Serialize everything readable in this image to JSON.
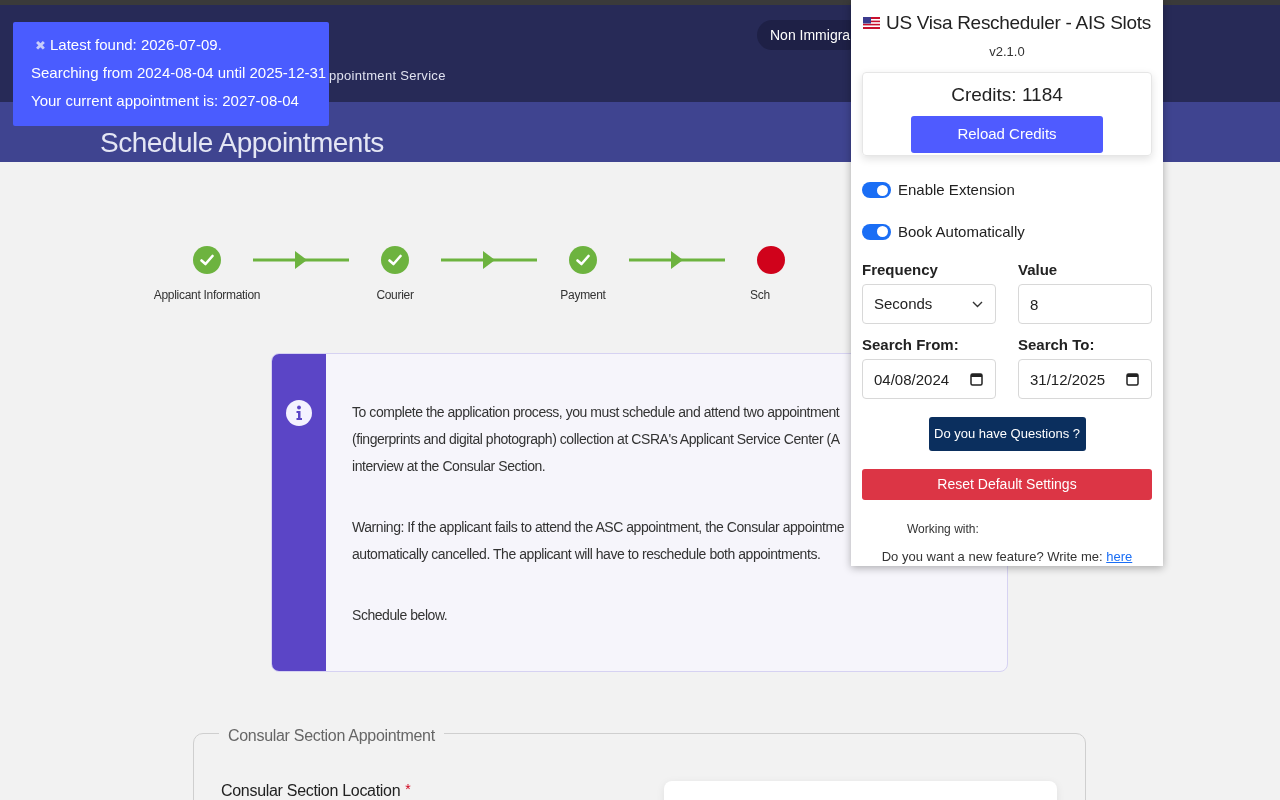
{
  "header": {
    "visa_pill": "Non Immigra",
    "service_text": "ppointment Service"
  },
  "banner": {
    "title": "Schedule Appointments"
  },
  "stepper": [
    {
      "label": "Applicant Information",
      "completed": true
    },
    {
      "label": "Courier",
      "completed": true
    },
    {
      "label": "Payment",
      "completed": true
    },
    {
      "label": "Sch",
      "completed": false
    }
  ],
  "info_box": {
    "paragraphs": [
      [
        "To complete the application process, you must schedule and attend two appointment",
        "(fingerprints and digital photograph) collection at CSRA's Applicant Service Center (A",
        "interview at the Consular Section."
      ],
      [
        "Warning: If the applicant fails to attend the ASC appointment, the Consular appointme",
        "automatically cancelled. The applicant will have to reschedule both appointments."
      ],
      [
        "Schedule below."
      ]
    ]
  },
  "consular_section": {
    "legend": "Consular Section Appointment",
    "location_label": "Consular Section Location",
    "required_mark": "*"
  },
  "notification": {
    "close_glyph": "✖",
    "lines": [
      "Latest found: 2026-07-09.",
      "Searching from 2024-08-04 until 2025-12-31",
      "Your current appointment is: 2027-08-04"
    ]
  },
  "popup": {
    "title": "US Visa Rescheduler - AIS Slots",
    "version": "v2.1.0",
    "credits": "Credits: 1184",
    "reload_button": "Reload Credits",
    "toggles": [
      {
        "label": "Enable Extension",
        "on": true
      },
      {
        "label": "Book Automatically",
        "on": true
      }
    ],
    "frequency": {
      "label": "Frequency",
      "value": "Seconds"
    },
    "value": {
      "label": "Value",
      "value": "8"
    },
    "search_from": {
      "label": "Search From:",
      "value": "04/08/2024"
    },
    "search_to": {
      "label": "Search To:",
      "value": "31/12/2025"
    },
    "questions_button": "Do you have Questions ?",
    "reset_button": "Reset Default Settings",
    "working_with": "Working with:",
    "feature_prompt": {
      "text": "Do you want a new feature? Write me:",
      "link": "here"
    }
  }
}
